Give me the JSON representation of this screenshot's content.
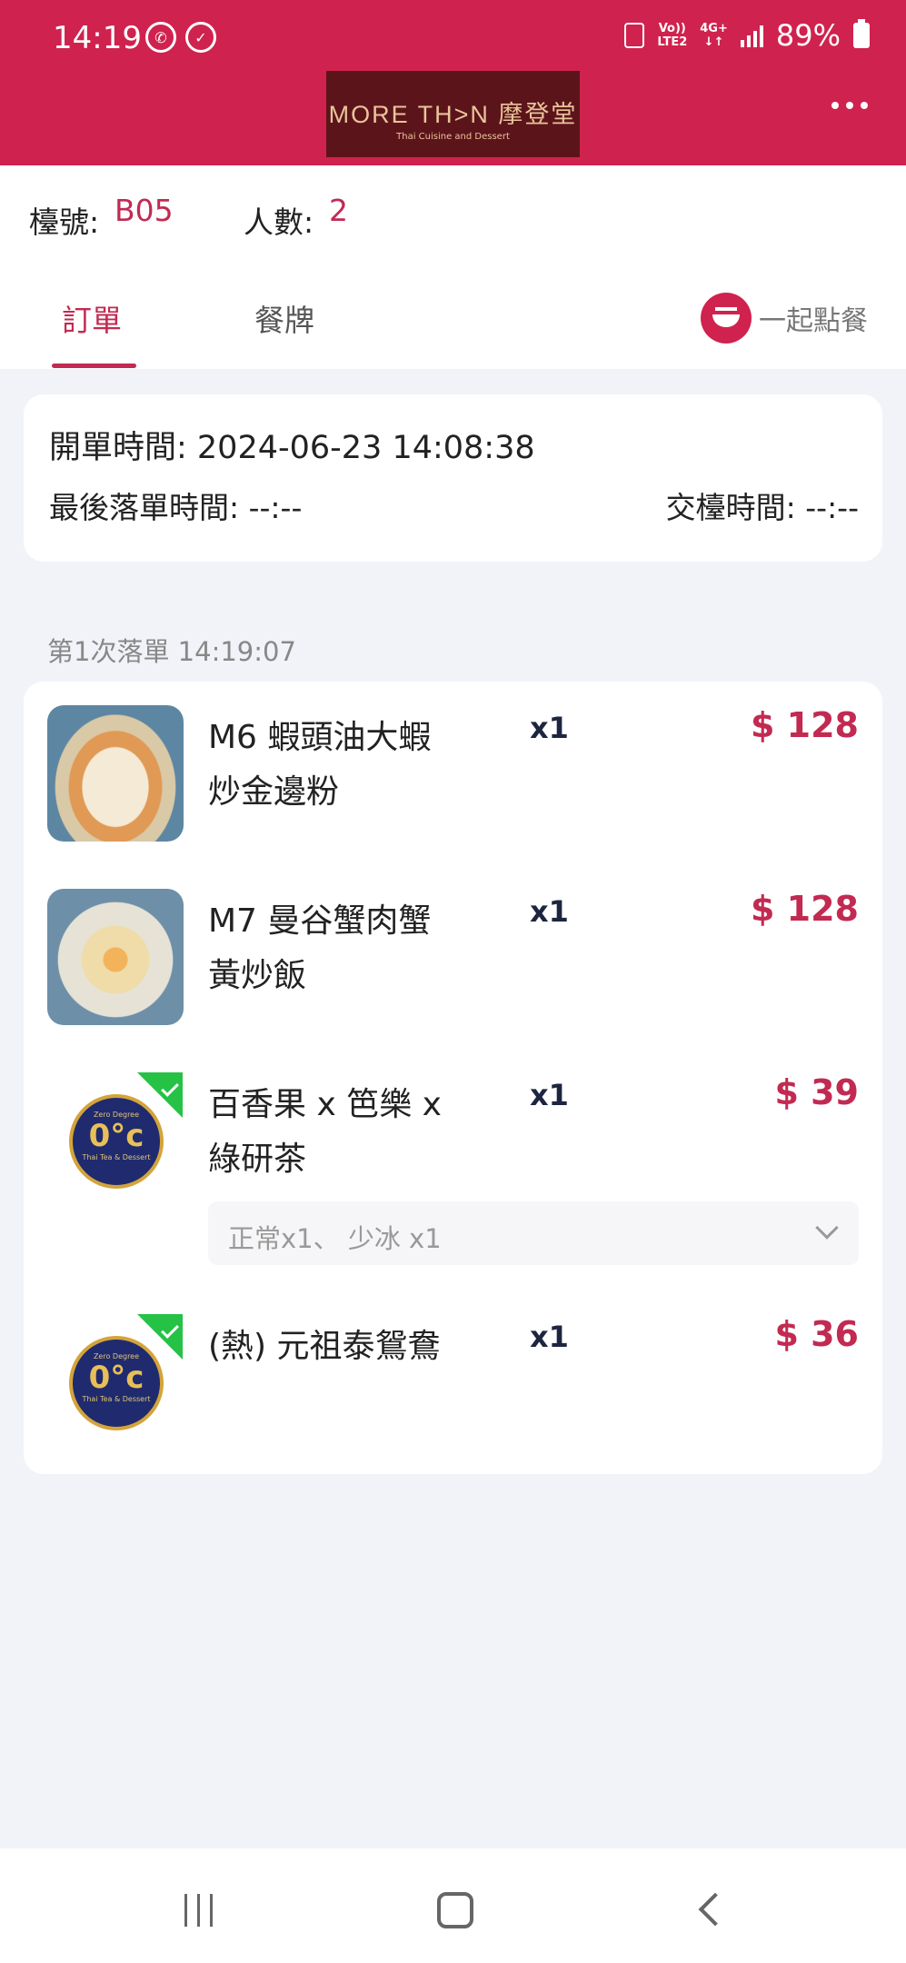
{
  "status_bar": {
    "time": "14:19",
    "network_top": "Vo))",
    "network_bottom": "LTE2",
    "net_gen": "4G+",
    "battery": "89%"
  },
  "header": {
    "logo_main": "MORE TH>N 摩登堂",
    "logo_sub": "Thai Cuisine and Dessert"
  },
  "info": {
    "table_label": "檯號:",
    "table_value": "B05",
    "people_label": "人數:",
    "people_value": "2"
  },
  "tabs": [
    {
      "label": "訂單",
      "active": true
    },
    {
      "label": "餐牌",
      "active": false
    }
  ],
  "together_label": "一起點餐",
  "order_info": {
    "open_time": "開單時間: 2024-06-23 14:08:38",
    "last_order_time": "最後落單時間: --:--",
    "checkout_time": "交檯時間: --:--"
  },
  "order_round_label": "第1次落單 14:19:07",
  "items": [
    {
      "name": "M6 蝦頭油大蝦炒金邊粉",
      "qty": "x1",
      "price": "$ 128",
      "thumb": "dish-photo"
    },
    {
      "name": "M7 曼谷蟹肉蟹黃炒飯",
      "qty": "x1",
      "price": "$ 128",
      "thumb": "dish-photo"
    },
    {
      "name": "百香果 x 笆樂 x 綠研茶",
      "qty": "x1",
      "price": "$ 39",
      "thumb": "brand-logo",
      "options": "正常x1、 少冰 x1"
    },
    {
      "name": "(熱) 元祖泰鴛鴦",
      "qty": "x1",
      "price": "$ 36",
      "thumb": "brand-logo"
    }
  ],
  "brand_logo": {
    "top": "Zero Degree",
    "main": "0°c",
    "bottom": "Thai Tea & Dessert"
  },
  "colors": {
    "primary": "#d0224e",
    "accent_text": "#c22a52",
    "check_green": "#26c246",
    "page_bg": "#f2f3f9"
  }
}
